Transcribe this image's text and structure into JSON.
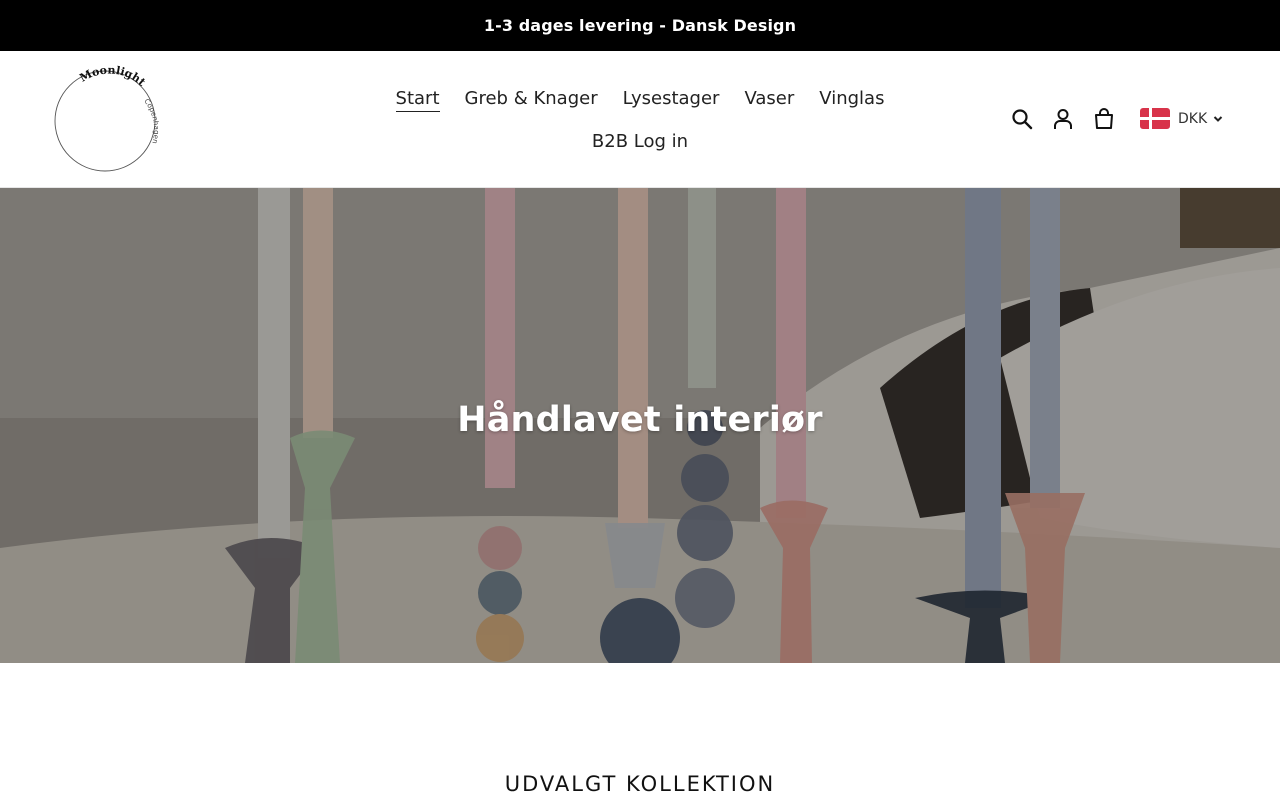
{
  "announcement": {
    "text": "1-3 dages levering - Dansk Design"
  },
  "logo": {
    "line1": "Moonlight",
    "line2": "Copenhagen"
  },
  "nav": {
    "items": [
      {
        "label": "Start",
        "active": true
      },
      {
        "label": "Greb & Knager"
      },
      {
        "label": "Lysestager"
      },
      {
        "label": "Vaser"
      },
      {
        "label": "Vinglas"
      },
      {
        "label": "B2B Log in"
      }
    ]
  },
  "header_icons": [
    "search-icon",
    "account-icon",
    "cart-icon"
  ],
  "currency": {
    "code": "DKK",
    "flag": "denmark-flag-icon"
  },
  "hero": {
    "title": "Håndlavet interiør"
  },
  "featured": {
    "title": "UDVALGT KOLLEKTION"
  },
  "colors": {
    "announce_bg": "#000000",
    "flag_red": "#d8334a",
    "overlay": "rgba(0,0,0,0.33)"
  }
}
